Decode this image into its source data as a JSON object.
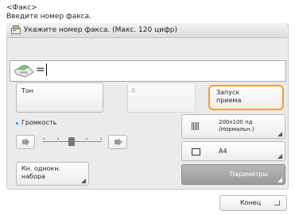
{
  "header": {
    "mode": "<Факс>",
    "instruction": "Введите номер факса."
  },
  "panel": {
    "title": "Укажите номер факса. (Макс. 120 цифр)",
    "input": {
      "prefix": "=",
      "value": ""
    }
  },
  "buttons": {
    "tone": "Тон",
    "r": "R",
    "start_line1": "Запуск",
    "start_line2": "приема",
    "speed_line1": "Кн. однокн.",
    "speed_line2": "набора",
    "params": "Параметры",
    "end": "Конец"
  },
  "volume": {
    "label": "Громкость",
    "level": 2,
    "max": 5
  },
  "settings": {
    "resolution_line1": "200x100 пд",
    "resolution_line2": "(Нормальн.)",
    "paper": "A4"
  },
  "colors": {
    "accent_orange": "#f0a030",
    "volume_dot": "#3a8fd8"
  },
  "icons": [
    "fax-icon",
    "phone-icon",
    "speaker-icon",
    "resolution-icon",
    "paper-icon",
    "enter-icon"
  ]
}
